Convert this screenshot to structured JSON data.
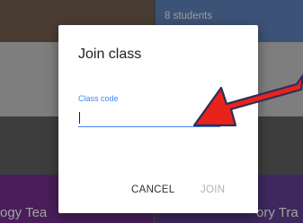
{
  "background": {
    "card_top_right_count": "8 students",
    "card_bottom_left_title": "ogy Tea",
    "card_bottom_right_title": "ory Tra"
  },
  "dialog": {
    "title": "Join class",
    "class_code_label": "Class code",
    "class_code_value": "",
    "cancel_label": "CANCEL",
    "join_label": "JOIN"
  },
  "annotation": {
    "arrow_color": "#e8231c",
    "arrow_outline": "#2d2d5a"
  },
  "colors": {
    "accent": "#4285f4",
    "disabled": "#b3b3b3"
  }
}
